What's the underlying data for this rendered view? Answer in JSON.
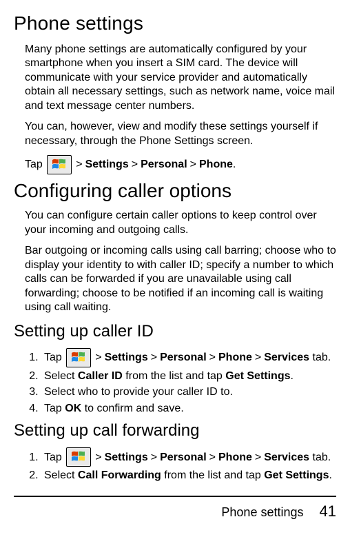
{
  "h1": "Phone settings",
  "p1": "Many phone settings are automatically configured by your smartphone when you insert a SIM card. The device will communicate with your service provider and automatically obtain all necessary settings, such as network name, voice mail and text message center numbers.",
  "p2": "You can, however, view and modify these settings yourself if necessary, through the Phone Settings screen.",
  "tap": {
    "prefix": "Tap ",
    "settings": "Settings",
    "personal": "Personal",
    "phone": "Phone",
    "services": "Services",
    "tab": " tab.",
    "period": "."
  },
  "sep": ">",
  "h1b": "Configuring caller options",
  "p3": "You can configure certain caller options to keep control over your incoming and outgoing calls.",
  "p4": "Bar outgoing or incoming calls using call barring; choose who to display your identity to with caller ID; specify a number to which calls can be forwarded if you are unavailable using call forwarding; choose to be notified if an incoming call is waiting using call waiting.",
  "h2a": "Setting up caller ID",
  "callerid": {
    "s2a": "Select ",
    "s2b": "Caller ID",
    "s2c": " from the list and tap ",
    "s2d": "Get Settings",
    "s3": "Select who to provide your caller ID to.",
    "s4a": "Tap ",
    "s4b": "OK",
    "s4c": " to confirm and save."
  },
  "h2b": "Setting up call forwarding",
  "fwd": {
    "s2a": "Select ",
    "s2b": "Call Forwarding",
    "s2c": " from the list and tap ",
    "s2d": "Get Settings"
  },
  "footer": {
    "section": "Phone settings",
    "page": "41"
  }
}
